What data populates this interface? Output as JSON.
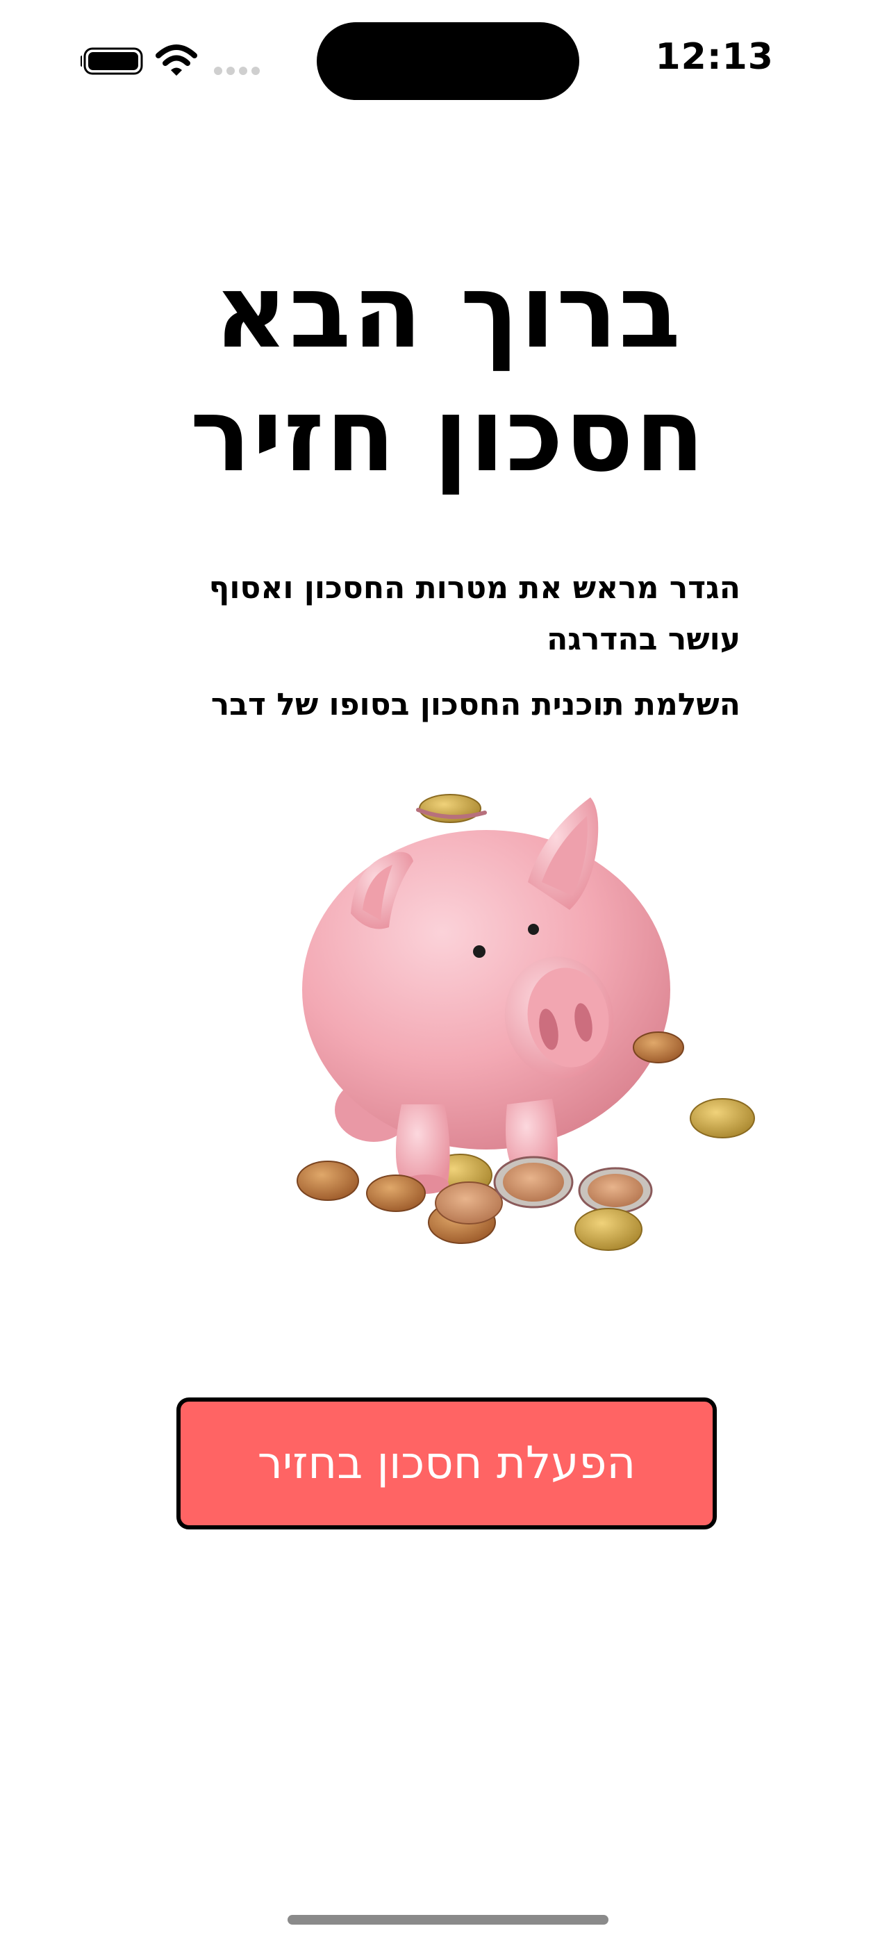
{
  "status_bar": {
    "time": "12:13",
    "icons": [
      "battery-icon",
      "wifi-icon",
      "cellular-signal-icon"
    ]
  },
  "welcome": {
    "title_line1": "ברוך הבא",
    "title_line2": "חסכון חזיר"
  },
  "description": {
    "paragraph1": "הגדר מראש את מטרות החסכון ואסוף עושר בהדרגה",
    "paragraph2": "השלמת תוכנית החסכון בסופו של דבר"
  },
  "illustration": {
    "icon": "piggy-bank-with-coins",
    "pig_color": "#f3a7b2",
    "coin_color": "#c98a4a"
  },
  "action": {
    "button_label": "הפעלת חסכון בחזיר",
    "button_color": "#ff6464"
  }
}
